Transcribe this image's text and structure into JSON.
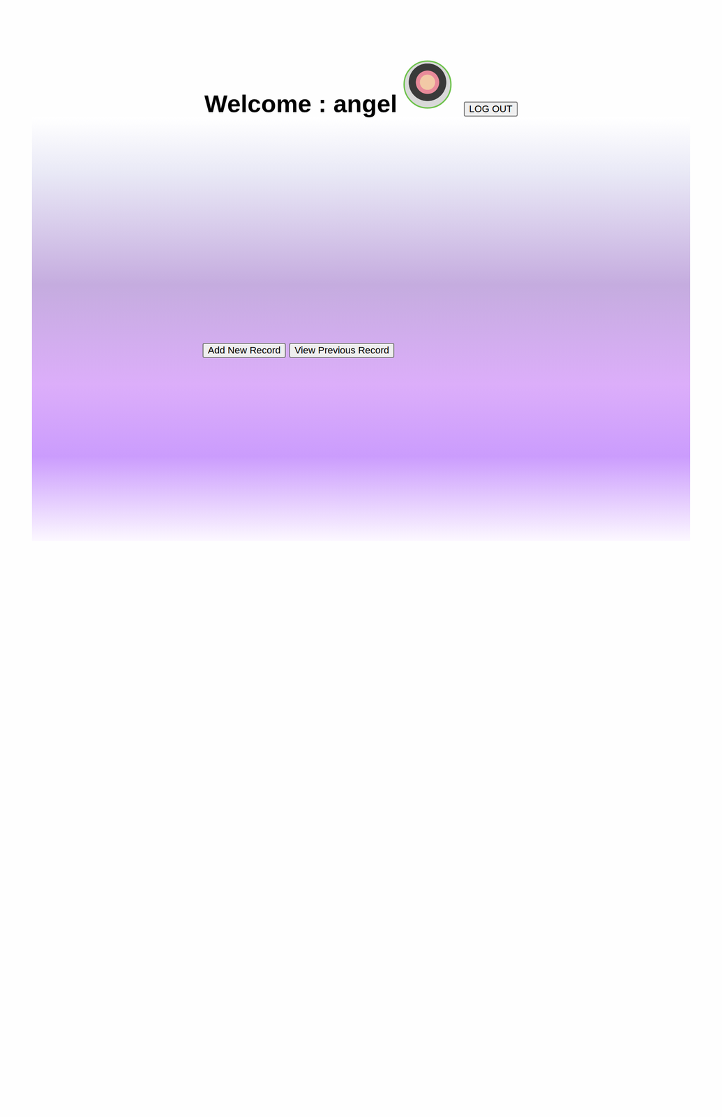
{
  "header": {
    "greeting": "Welcome : angel",
    "logout": "LOG OUT"
  },
  "actions": [
    "Add New Record",
    "View Previous Record"
  ]
}
